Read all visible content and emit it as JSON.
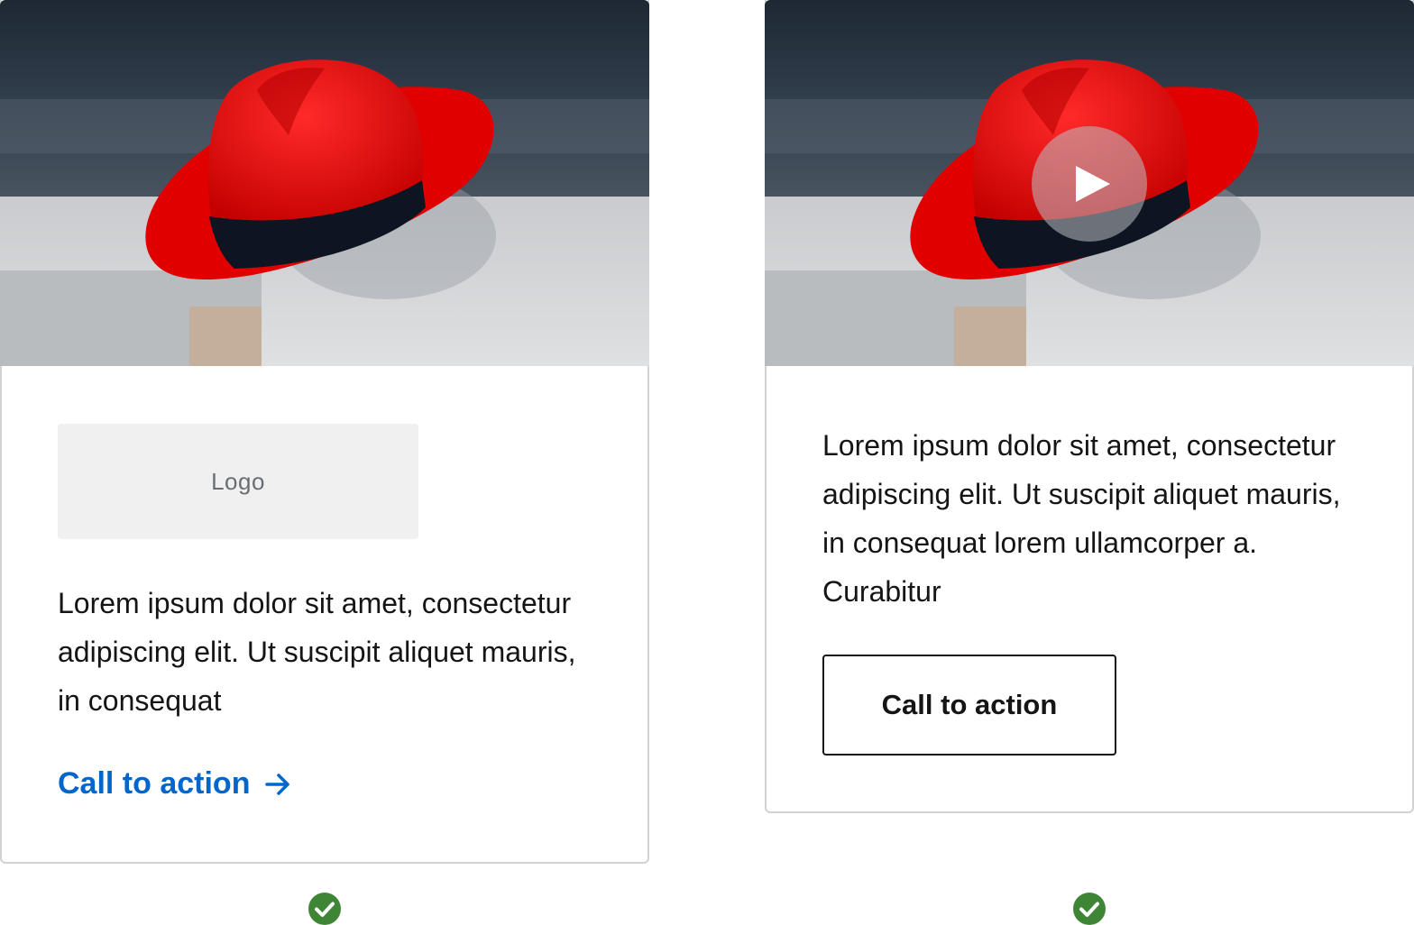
{
  "cards": [
    {
      "media_alt": "red fedora hat on a shelf",
      "logo_placeholder": "Logo",
      "body": "Lorem ipsum dolor sit amet, consectetur adipiscing elit. Ut suscipit aliquet mauris, in consequat",
      "cta_label": "Call to action",
      "cta_style": "link",
      "cta_icon": "arrow-right-icon",
      "status_icon": "check-circle-icon"
    },
    {
      "media_alt": "red fedora hat on a shelf",
      "media_overlay_icon": "play-icon",
      "body": "Lorem ipsum dolor sit amet, consectetur adipiscing elit. Ut suscipit aliquet mauris, in consequat lorem ullamcorper a. Curabitur",
      "cta_label": "Call to action",
      "cta_style": "secondary-button",
      "status_icon": "check-circle-icon"
    }
  ],
  "colors": {
    "link": "#0066cc",
    "hat": "#e00000",
    "success": "#3e8635",
    "text": "#151515",
    "border": "#d2d2d2"
  }
}
